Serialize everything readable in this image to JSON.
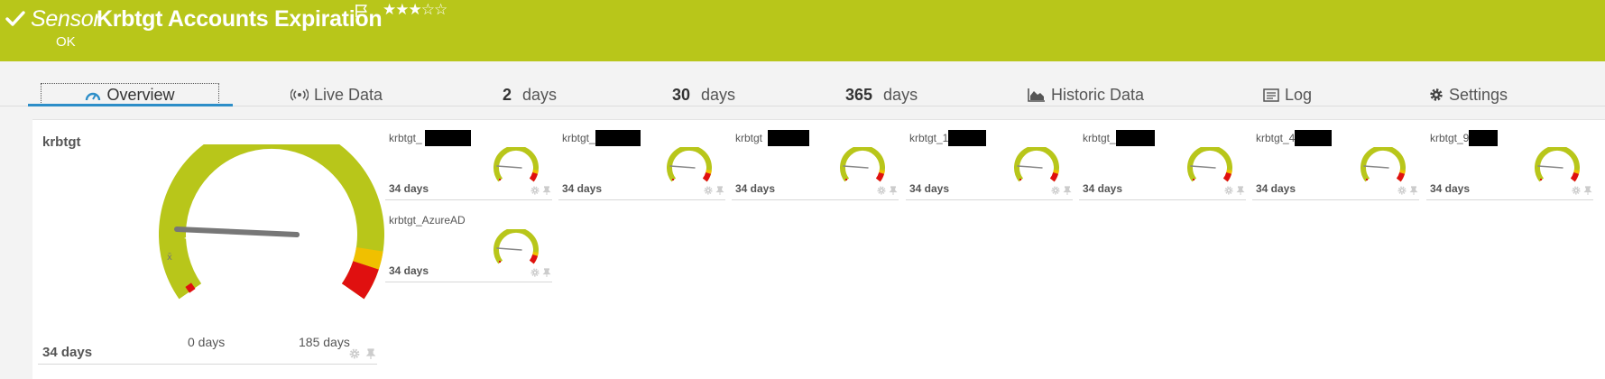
{
  "header": {
    "sensor_word": "Sensor",
    "sensor_name": "Krbtgt Accounts Expiration",
    "status": "OK",
    "stars": "★★★☆☆",
    "flag_icon": "flag-icon",
    "check_icon": "check-icon"
  },
  "tabs": [
    {
      "label": "Overview",
      "icon": "gauge-icon"
    },
    {
      "label": "Live Data",
      "icon": "broadcast-icon"
    },
    {
      "number": "2",
      "label": "days"
    },
    {
      "number": "30",
      "label": "days"
    },
    {
      "number": "365",
      "label": "days"
    },
    {
      "label": "Historic Data",
      "icon": "area-chart-icon"
    },
    {
      "label": "Log",
      "icon": "log-icon"
    },
    {
      "label": "Settings",
      "icon": "gear-icon"
    }
  ],
  "main_gauge": {
    "title": "krbtgt",
    "value_text": "34 days",
    "min_label": "0 days",
    "max_label": "185 days",
    "value": 34,
    "min": 0,
    "max": 185
  },
  "channels": [
    {
      "name": "krbtgt_",
      "value_text": "34 days"
    },
    {
      "name": "krbtgt_",
      "value_text": "34 days"
    },
    {
      "name": "krbtgt",
      "value_text": "34 days"
    },
    {
      "name": "krbtgt_1",
      "value_text": "34 days"
    },
    {
      "name": "krbtgt_",
      "value_text": "34 days"
    },
    {
      "name": "krbtgt_4",
      "value_text": "34 days"
    },
    {
      "name": "krbtgt_9",
      "value_text": "34 days"
    },
    {
      "name": "krbtgt_AzureAD",
      "value_text": "34 days"
    }
  ],
  "colors": {
    "header_bg": "#b8c61a",
    "gauge_green": "#b8c61a",
    "gauge_yellow": "#f0c000",
    "gauge_red": "#e01010",
    "needle": "#777777",
    "tab_accent": "#2d8ec8"
  }
}
